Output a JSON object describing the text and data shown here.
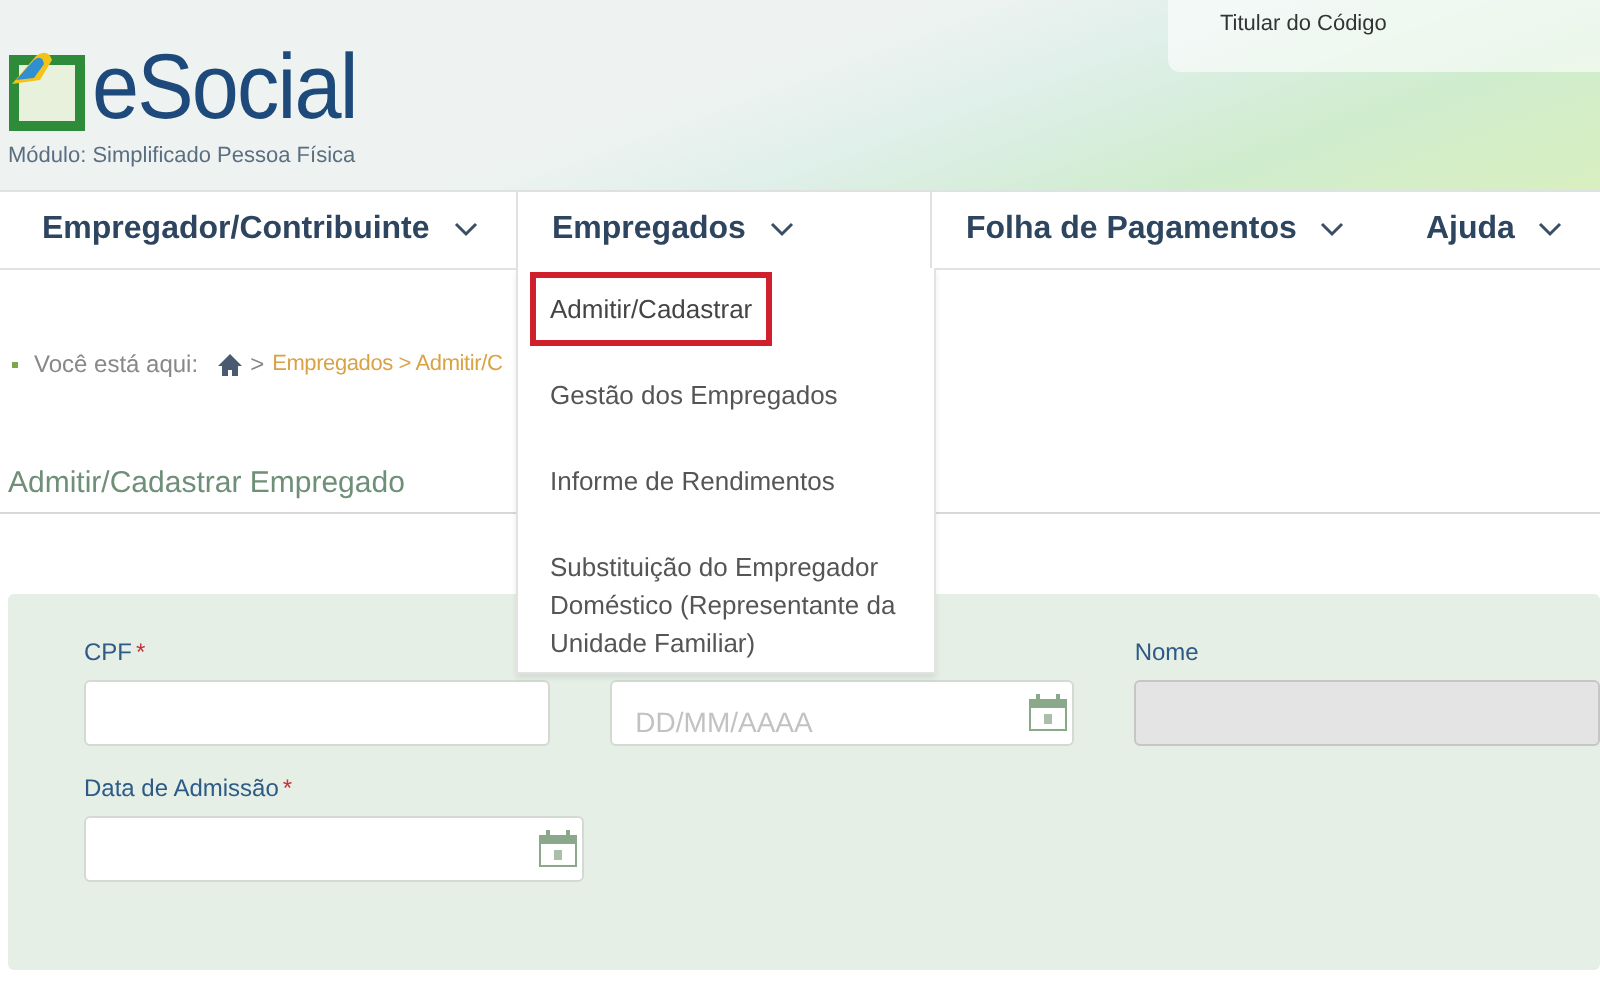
{
  "header": {
    "logo": "eSocial",
    "module": "Módulo: Simplificado Pessoa Física",
    "user_box": "Titular do Código"
  },
  "nav": [
    {
      "label": "Empregador/Contribuinte",
      "expanded": false
    },
    {
      "label": "Empregados",
      "expanded": true
    },
    {
      "label": "Folha de Pagamentos",
      "expanded": false
    },
    {
      "label": "Ajuda",
      "expanded": false
    }
  ],
  "dropdown": [
    {
      "label": "Admitir/Cadastrar",
      "selected": true
    },
    {
      "label": "Gestão dos Empregados",
      "selected": false
    },
    {
      "label": "Informe de Rendimentos",
      "selected": false
    },
    {
      "label": "Substituição do Empregador Doméstico (Representante da Unidade Familiar)",
      "selected": false
    }
  ],
  "breadcrumb": {
    "label": "Você está aqui:",
    "separator": ">",
    "path": "Empregados > Admitir/C"
  },
  "page_title": "Admitir/Cadastrar Empregado",
  "form": {
    "rows": [
      [
        {
          "label": "CPF",
          "required_mark": "*",
          "kind": "text",
          "disabled": false
        },
        {
          "placeholder": "DD/MM/AAAA",
          "kind": "date",
          "disabled": false
        },
        {
          "label": "Nome",
          "kind": "text",
          "disabled": true
        }
      ],
      [
        {
          "label": "Data de Admissão",
          "required_mark": "*",
          "kind": "date",
          "disabled": false
        }
      ]
    ]
  }
}
